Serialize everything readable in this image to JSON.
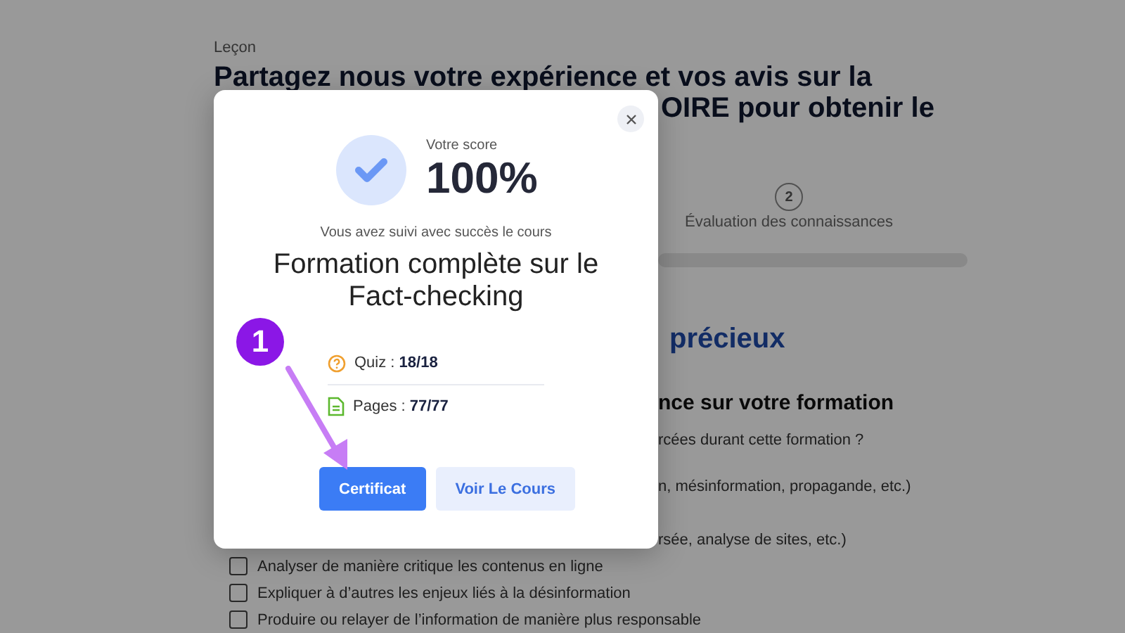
{
  "page": {
    "breadcrumb": "Leçon",
    "heading_lines": [
      "Partagez nous votre expérience et vos avis sur la",
      "OIRE pour obtenir le"
    ],
    "step": {
      "number": "2",
      "label": "Évaluation des connaissances"
    },
    "section_title": "précieux",
    "question_title": "nce sur votre formation",
    "question": "rcées durant cette formation ?",
    "fragment": "n, mésinformation, propagande, etc.)",
    "options": [
      {
        "label": "rsée, analyse de sites, etc.)"
      },
      {
        "label": "Analyser de manière critique les contenus en ligne",
        "checked": false
      },
      {
        "label": "Expliquer à d’autres les enjeux liés à la désinformation",
        "checked": false
      },
      {
        "label": "Produire ou relayer de l’information de manière plus responsable",
        "checked": false
      }
    ]
  },
  "modal": {
    "score_label": "Votre score",
    "score": "100%",
    "subtitle": "Vous avez suivi avec succès le cours",
    "course_title": "Formation complète sur le Fact-checking",
    "stats": [
      {
        "kind": "quiz",
        "text": "Quiz : **18/18**"
      },
      {
        "kind": "pages",
        "text": "Pages : **77/77**"
      }
    ],
    "buttons": [
      {
        "label": "Certificat",
        "kind": "primary"
      },
      {
        "label": "Voir Le Cours",
        "kind": "secondary"
      }
    ]
  },
  "annotation": {
    "label": "1"
  }
}
